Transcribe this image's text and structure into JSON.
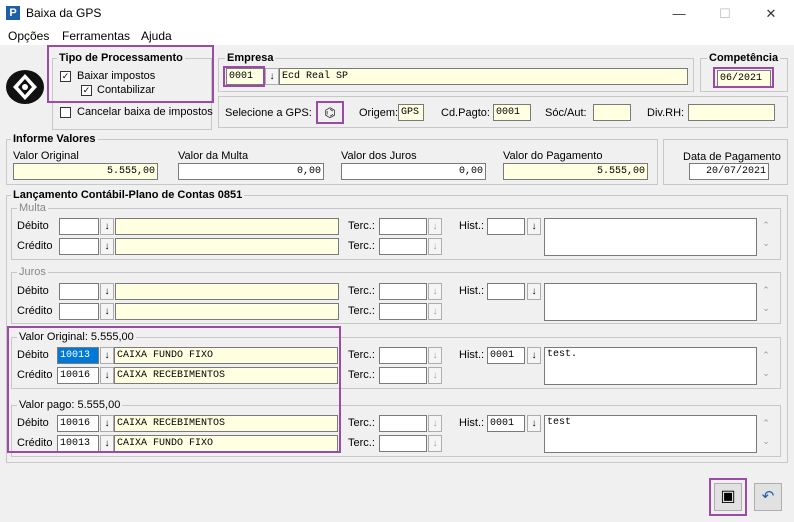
{
  "window": {
    "title": "Baixa da GPS",
    "app_icon": "P",
    "minimize": "—",
    "maximize": "☐",
    "close": "✕"
  },
  "menu": [
    "Opções",
    "Ferramentas",
    "Ajuda"
  ],
  "tipo": {
    "title": "Tipo de Processamento",
    "baixar_label": "Baixar impostos",
    "baixar_checked": true,
    "contabilizar_label": "Contabilizar",
    "contabilizar_checked": true,
    "cancelar_label": "Cancelar baixa de impostos",
    "cancelar_checked": false
  },
  "empresa": {
    "title": "Empresa",
    "code": "0001",
    "name": "Ecd Real SP"
  },
  "competencia": {
    "title": "Competência",
    "value": "06/2021"
  },
  "gps": {
    "select_label": "Selecione a GPS:",
    "origem_label": "Origem:",
    "origem_value": "GPS",
    "cdpagto_label": "Cd.Pagto:",
    "cdpagto_value": "0001",
    "socaut_label": "Sóc/Aut:",
    "divrh_label": "Div.RH:"
  },
  "informe": {
    "title": "Informe Valores",
    "valor_original_label": "Valor Original",
    "valor_original": "5.555,00",
    "valor_multa_label": "Valor da Multa",
    "valor_multa": "0,00",
    "valor_juros_label": "Valor dos Juros",
    "valor_juros": "0,00",
    "valor_pagamento_label": "Valor do Pagamento",
    "valor_pagamento": "5.555,00"
  },
  "data_pagamento": {
    "label": "Data de Pagamento",
    "value": "20/07/2021"
  },
  "lancamento": {
    "title": "Lançamento Contábil-Plano de Contas 0851",
    "debito_label": "Débito",
    "credito_label": "Crédito",
    "terc_label": "Terc.:",
    "hist_label": "Hist.:",
    "multa": {
      "title": "Multa"
    },
    "juros": {
      "title": "Juros"
    },
    "valor_original": {
      "title": "Valor Original: 5.555,00",
      "debito_code": "10013",
      "debito_name": "CAIXA FUNDO FIXO",
      "credito_code": "10016",
      "credito_name": "CAIXA RECEBIMENTOS",
      "hist_code": "0001",
      "hist_text": "test."
    },
    "valor_pago": {
      "title": "Valor pago: 5.555,00",
      "debito_code": "10016",
      "debito_name": "CAIXA RECEBIMENTOS",
      "credito_code": "10013",
      "credito_name": "CAIXA FUNDO FIXO",
      "hist_code": "0001",
      "hist_text": "test"
    }
  },
  "icons": {
    "dropdown": "↓",
    "scroll_up": "⌃",
    "scroll_down": "⌄",
    "check": "✓",
    "binoculars": "⌬",
    "save": "▣",
    "undo": "↶"
  }
}
